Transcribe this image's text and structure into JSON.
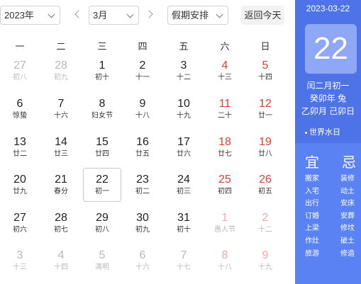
{
  "toolbar": {
    "year": "2023年",
    "month": "3月",
    "holiday": "假期安排",
    "today_button": "返回今天"
  },
  "weekdays": [
    "一",
    "二",
    "三",
    "四",
    "五",
    "六",
    "日"
  ],
  "weeks": [
    [
      {
        "num": "27",
        "lunar": "初八",
        "faded": true
      },
      {
        "num": "28",
        "lunar": "初九",
        "faded": true
      },
      {
        "num": "1",
        "lunar": "初十"
      },
      {
        "num": "2",
        "lunar": "十一"
      },
      {
        "num": "3",
        "lunar": "十二"
      },
      {
        "num": "4",
        "lunar": "十三",
        "red": true
      },
      {
        "num": "5",
        "lunar": "十四",
        "red": true
      }
    ],
    [
      {
        "num": "6",
        "lunar": "惊蛰"
      },
      {
        "num": "7",
        "lunar": "十六"
      },
      {
        "num": "8",
        "lunar": "妇女节"
      },
      {
        "num": "9",
        "lunar": "十八"
      },
      {
        "num": "10",
        "lunar": "十九"
      },
      {
        "num": "11",
        "lunar": "二十",
        "red": true
      },
      {
        "num": "12",
        "lunar": "廿一",
        "red": true
      }
    ],
    [
      {
        "num": "13",
        "lunar": "廿二"
      },
      {
        "num": "14",
        "lunar": "廿三"
      },
      {
        "num": "15",
        "lunar": "廿四"
      },
      {
        "num": "16",
        "lunar": "廿五"
      },
      {
        "num": "17",
        "lunar": "廿六"
      },
      {
        "num": "18",
        "lunar": "廿七",
        "red": true
      },
      {
        "num": "19",
        "lunar": "廿八",
        "red": true
      }
    ],
    [
      {
        "num": "20",
        "lunar": "廿九"
      },
      {
        "num": "21",
        "lunar": "春分"
      },
      {
        "num": "22",
        "lunar": "初一",
        "selected": true
      },
      {
        "num": "23",
        "lunar": "初二"
      },
      {
        "num": "24",
        "lunar": "初三"
      },
      {
        "num": "25",
        "lunar": "初四",
        "red": true
      },
      {
        "num": "26",
        "lunar": "初五",
        "red": true
      }
    ],
    [
      {
        "num": "27",
        "lunar": "初六"
      },
      {
        "num": "28",
        "lunar": "初七"
      },
      {
        "num": "29",
        "lunar": "初八"
      },
      {
        "num": "30",
        "lunar": "初九"
      },
      {
        "num": "31",
        "lunar": "初十"
      },
      {
        "num": "1",
        "lunar": "愚人节",
        "faded": true,
        "red": true
      },
      {
        "num": "2",
        "lunar": "十二",
        "faded": true,
        "red": true
      }
    ],
    [
      {
        "num": "3",
        "lunar": "十三",
        "faded": true
      },
      {
        "num": "4",
        "lunar": "十四",
        "faded": true
      },
      {
        "num": "5",
        "lunar": "清明",
        "faded": true
      },
      {
        "num": "6",
        "lunar": "十六",
        "faded": true
      },
      {
        "num": "7",
        "lunar": "十七",
        "faded": true
      },
      {
        "num": "8",
        "lunar": "十八",
        "faded": true,
        "red": true
      },
      {
        "num": "9",
        "lunar": "十九",
        "faded": true,
        "red": true
      }
    ]
  ],
  "side": {
    "date": "2023-03-22",
    "day": "22",
    "lunar_lines": [
      "闰二月初一",
      "癸卯年 兔",
      "乙卯月 己卯日"
    ],
    "festival": "世界水日",
    "yi_title": "宜",
    "ji_title": "忌",
    "yi": [
      "搬家",
      "入宅",
      "出行",
      "订婚",
      "上梁",
      "作灶",
      "旅游"
    ],
    "ji": [
      "装修",
      "动土",
      "安床",
      "安葬",
      "修坟",
      "破土",
      "修造"
    ]
  },
  "colors": {
    "accent": "#4e73e8",
    "side_lower": "#5b82f2",
    "weekend_red": "#e03c31"
  }
}
